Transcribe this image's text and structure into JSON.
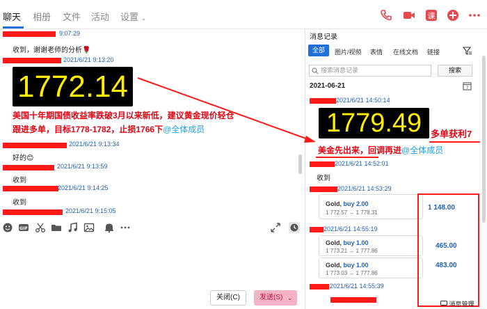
{
  "tabs": [
    "聊天",
    "相册",
    "文件",
    "活动",
    "设置"
  ],
  "top_icons": [
    "phone-icon",
    "video-icon",
    "course-icon",
    "add-icon",
    "more-icon"
  ],
  "chat": {
    "m1_time": "9:07:29",
    "m1_text": "收到，谢谢老师的分析🌹",
    "m2_time": "2021/6/21 9:13:20",
    "m2_price": "1772.14",
    "m2_text_line1": "美国十年期国债收益率跌破3月以来新低，建议黄金现价轻仓",
    "m2_text_line2": "跟进多单，目标1778-1782，止损1766下",
    "m2_at": "@全体成员",
    "m3_time": "2021/6/21 9:13:34",
    "m3_text": "好的😊",
    "m4_time": "2021/6/21 9:13:59",
    "m4_text": "收到",
    "m5_time": "2021/6/21 9:14:25",
    "m5_text": "收到",
    "m6_time": "2021/6/21 9:15:05"
  },
  "toolbar_icons": [
    "emoji-icon",
    "gif-icon",
    "scissors-icon",
    "folder-icon",
    "music-icon",
    "image-icon",
    "bell-icon",
    "more-icon"
  ],
  "buttons": {
    "close": "关闭(C)",
    "send": "发送(S)"
  },
  "history": {
    "title": "消息记录",
    "filters": [
      "全部",
      "图片/视频",
      "表情",
      "在线文档",
      "链接"
    ],
    "search_placeholder": "搜索消息记录",
    "search_button": "搜索",
    "date": "2021-06-21",
    "h1_time": "2021/6/21 14:50:14",
    "h1_price": "1779.49",
    "h1_overlay": "多单获利7",
    "h1_text": "美金先出来，回调再进",
    "h1_at": "@全体成员",
    "h2_time": "2021/6/21 14:52:01",
    "h2_text": "收到",
    "h3_time": "2021/6/21 14:53:29",
    "trade1": {
      "asset": "Gold",
      "action": "buy 2.00",
      "price": "1 772.57 → 1 778.31",
      "amount": "1 148.00"
    },
    "h4_time": "2021/6/21 14:55:19",
    "trade2": {
      "asset": "Gold",
      "action": "buy 1.00",
      "price": "1 773.21 → 1 777.86",
      "amount": "465.00"
    },
    "trade3": {
      "asset": "Gold",
      "action": "buy 1.00",
      "price": "1 773.03 → 1 777.86",
      "amount": "483.00"
    },
    "h5_time": "2021/6/21 14:55:39",
    "manage": "消息管理"
  },
  "colors": {
    "accent": "#1e6fd9",
    "annotation_red": "#e50012",
    "price_yellow": "#ffec00"
  }
}
